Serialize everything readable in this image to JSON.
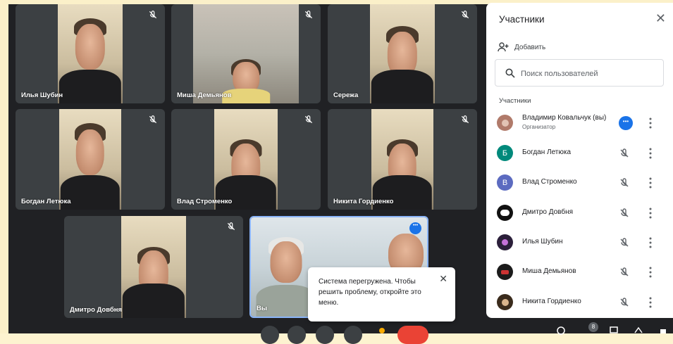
{
  "tiles": [
    {
      "name": "Илья Шубин"
    },
    {
      "name": "Миша Демьянов"
    },
    {
      "name": "Сережа"
    },
    {
      "name": "Богдан Летюка"
    },
    {
      "name": "Влад Строменко"
    },
    {
      "name": "Никита Гордиенко"
    },
    {
      "name": "Дмитро Довбня"
    },
    {
      "name": "Вы"
    }
  ],
  "tooltip": {
    "text": "Система перегружена. Чтобы решить проблему, откройте это меню."
  },
  "panel": {
    "title": "Участники",
    "add_label": "Добавить",
    "search_placeholder": "Поиск пользователей",
    "section_label": "Участники",
    "participants": [
      {
        "name": "Владимир Ковальчук (вы)",
        "role": "Организатор",
        "initial": ""
      },
      {
        "name": "Богдан Летюка",
        "initial": "Б",
        "color": "#00897b"
      },
      {
        "name": "Влад Строменко",
        "initial": "В",
        "color": "#5c6bc0"
      },
      {
        "name": "Дмитро Довбня",
        "initial": ""
      },
      {
        "name": "Илья Шубин",
        "initial": ""
      },
      {
        "name": "Миша Демьянов",
        "initial": ""
      },
      {
        "name": "Никита Гордиенко",
        "initial": ""
      }
    ]
  },
  "bottombar": {
    "badge_count": "8"
  },
  "colors": {
    "accent": "#1a73e8",
    "leave": "#ea4335",
    "stage": "#202124",
    "tile": "#3c4043"
  }
}
